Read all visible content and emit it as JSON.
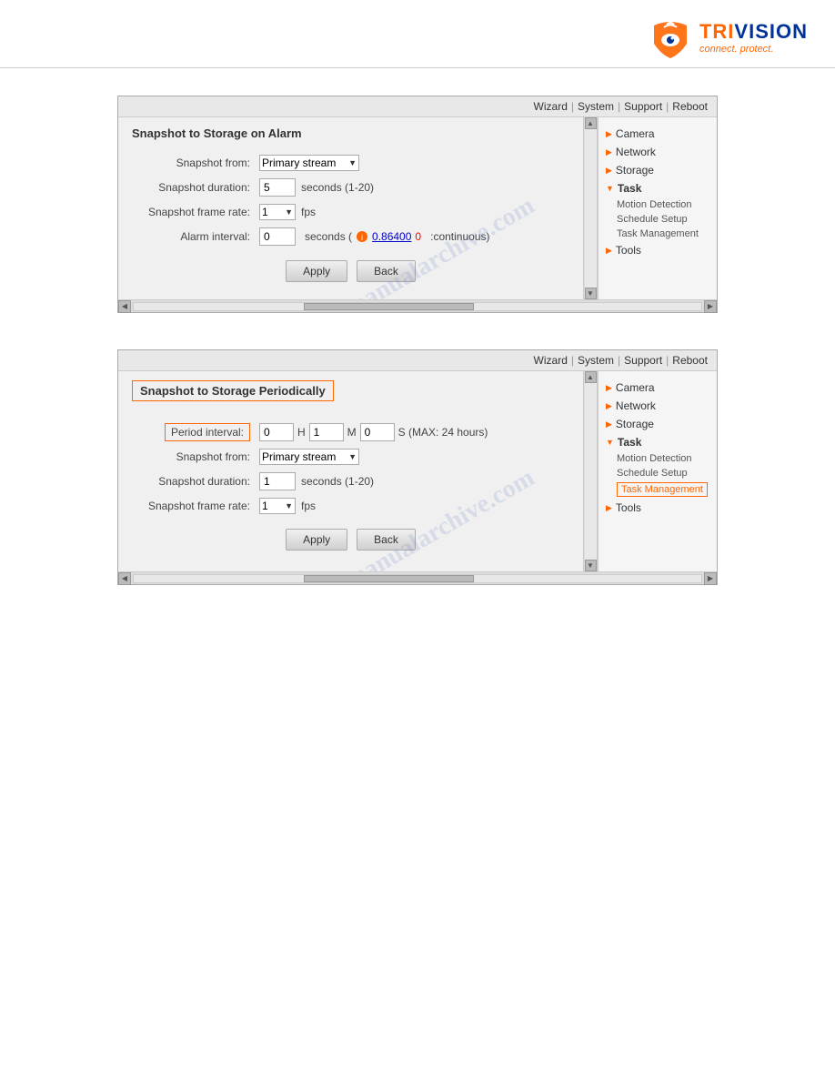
{
  "header": {
    "logo_text": "TRIVISION",
    "logo_text_highlight": "TRI",
    "tagline": "connect. protect.",
    "nav_links": [
      "Wizard",
      "System",
      "Support",
      "Reboot"
    ]
  },
  "panel1": {
    "title": "Snapshot to Storage on Alarm",
    "fields": {
      "snapshot_from_label": "Snapshot from:",
      "snapshot_from_value": "Primary stream",
      "snapshot_duration_label": "Snapshot duration:",
      "snapshot_duration_value": "5",
      "snapshot_duration_suffix": "seconds (1-20)",
      "snapshot_frame_rate_label": "Snapshot frame rate:",
      "snapshot_frame_rate_value": "1",
      "snapshot_frame_rate_suffix": "fps",
      "alarm_interval_label": "Alarm interval:",
      "alarm_interval_value": "0",
      "alarm_interval_credit_link": "0.86400",
      "alarm_interval_credit_value": "0",
      "alarm_interval_suffix": ":continuous)"
    },
    "buttons": {
      "apply": "Apply",
      "back": "Back"
    },
    "sidebar": {
      "items": [
        {
          "label": "Camera",
          "expanded": false
        },
        {
          "label": "Network",
          "expanded": false
        },
        {
          "label": "Storage",
          "expanded": false
        },
        {
          "label": "Task",
          "expanded": true
        },
        {
          "label": "Tools",
          "expanded": false
        }
      ],
      "sub_items": [
        {
          "label": "Motion Detection",
          "parent": "Task"
        },
        {
          "label": "Schedule Setup",
          "parent": "Task"
        },
        {
          "label": "Task Management",
          "parent": "Task",
          "active": false
        }
      ]
    }
  },
  "panel2": {
    "title": "Snapshot to Storage Periodically",
    "period_label": "Period interval:",
    "period_h_value": "0",
    "period_h_label": "H",
    "period_m_value": "1",
    "period_m_label": "M",
    "period_s_value": "0",
    "period_s_suffix": "S (MAX: 24 hours)",
    "snapshot_from_label": "Snapshot from:",
    "snapshot_from_value": "Primary stream",
    "snapshot_duration_label": "Snapshot duration:",
    "snapshot_duration_value": "1",
    "snapshot_duration_suffix": "seconds (1-20)",
    "snapshot_frame_rate_label": "Snapshot frame rate:",
    "snapshot_frame_rate_value": "1",
    "snapshot_frame_rate_suffix": "fps",
    "buttons": {
      "apply": "Apply",
      "back": "Back"
    },
    "sidebar": {
      "items": [
        {
          "label": "Camera",
          "expanded": false
        },
        {
          "label": "Network",
          "expanded": false
        },
        {
          "label": "Storage",
          "expanded": false
        },
        {
          "label": "Task",
          "expanded": true
        },
        {
          "label": "Tools",
          "expanded": false
        }
      ],
      "sub_items": [
        {
          "label": "Motion Detection",
          "parent": "Task"
        },
        {
          "label": "Schedule Setup",
          "parent": "Task"
        },
        {
          "label": "Task Management",
          "parent": "Task",
          "active": true
        }
      ]
    }
  },
  "watermark1": "manualarchive.com",
  "watermark2": "manualarchive.com"
}
